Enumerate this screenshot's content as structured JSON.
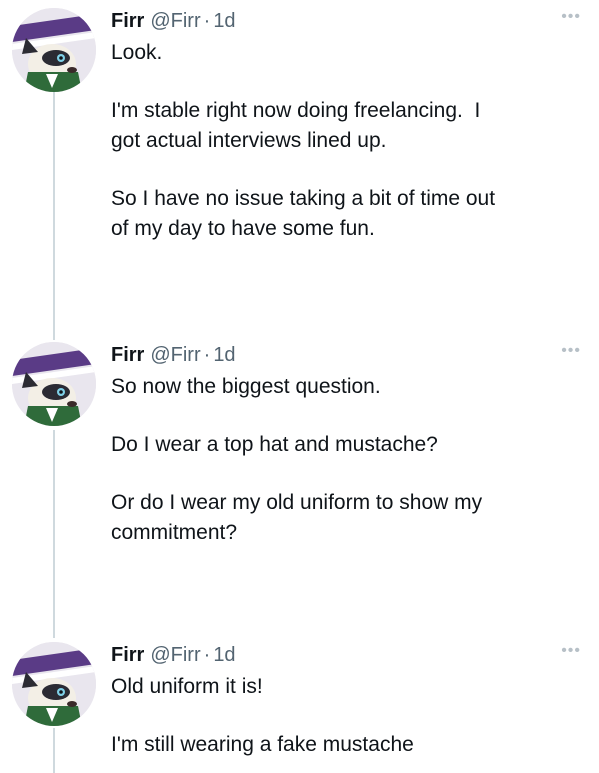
{
  "tweets": [
    {
      "name": "Firr",
      "handle": "@Firr",
      "separator": "·",
      "time": "1d",
      "more_icon": "more-horizontal-icon",
      "paragraphs": [
        "Look.",
        "I'm stable right now doing freelancing.  I\ngot actual interviews lined up.",
        "So I have no issue taking a bit of time out\nof my day to have some fun."
      ]
    },
    {
      "name": "Firr",
      "handle": "@Firr",
      "separator": "·",
      "time": "1d",
      "more_icon": "more-horizontal-icon",
      "paragraphs": [
        "So now the biggest question.",
        "Do I wear a top hat and mustache?",
        "Or do I wear my old uniform to show my\ncommitment?"
      ]
    },
    {
      "name": "Firr",
      "handle": "@Firr",
      "separator": "·",
      "time": "1d",
      "more_icon": "more-horizontal-icon",
      "paragraphs": [
        "Old uniform it is!",
        "I'm still wearing a fake mustache"
      ]
    }
  ],
  "colors": {
    "text": "#0f1419",
    "secondary": "#536471",
    "thread_line": "#cfd9de",
    "avatar_purple": "#5a3b86",
    "avatar_green": "#2f6b3a"
  }
}
